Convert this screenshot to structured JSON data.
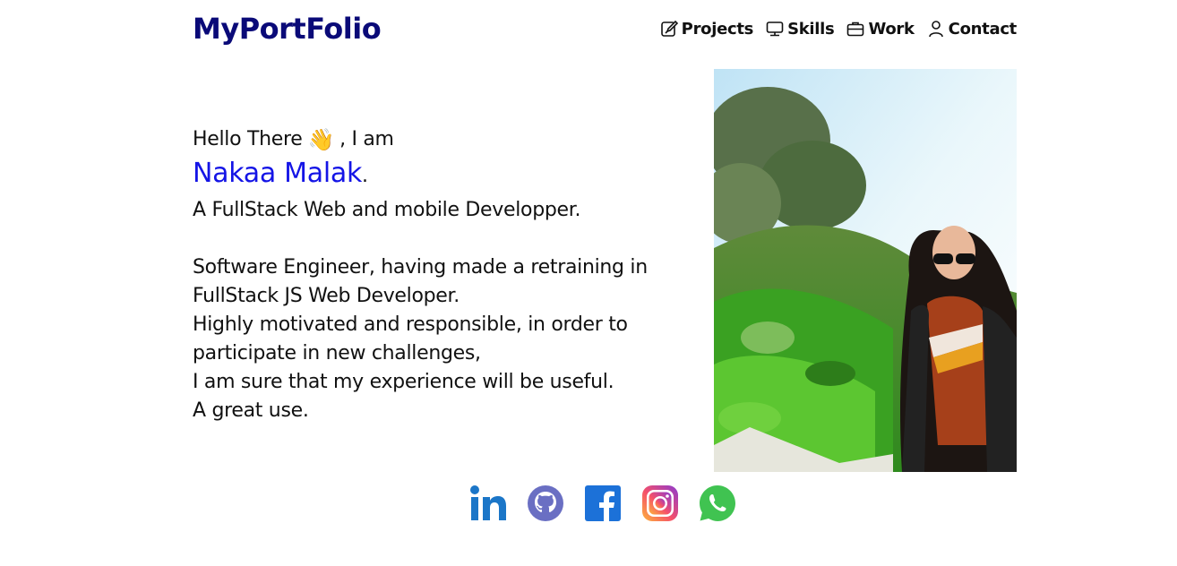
{
  "header": {
    "logo": "MyPortFolio",
    "nav": [
      {
        "label": "Projects",
        "icon": "edit-icon"
      },
      {
        "label": "Skills",
        "icon": "monitor-icon"
      },
      {
        "label": "Work",
        "icon": "briefcase-icon"
      },
      {
        "label": "Contact",
        "icon": "person-icon"
      }
    ]
  },
  "intro": {
    "greeting_before": "Hello There",
    "wave": "👋",
    "greeting_after": ", I am",
    "name": "Nakaa Malak",
    "name_dot": ".",
    "role": "A FullStack Web and mobile Developper.",
    "bio": [
      "Software Engineer, having made a retraining in",
      "FullStack JS Web Developer.",
      "Highly motivated and responsible, in order to",
      "participate in new challenges,",
      "I am sure that my experience will be useful.",
      "A great use."
    ]
  },
  "colors": {
    "logo": "#0a0a78",
    "name": "#1414e6",
    "linkedin": "#1b76c8",
    "github": "#6a6fc3",
    "facebook": "#1c71d8",
    "whatsapp": "#40c351"
  },
  "socials": [
    {
      "name": "linkedin-icon"
    },
    {
      "name": "github-icon"
    },
    {
      "name": "facebook-icon"
    },
    {
      "name": "instagram-icon"
    },
    {
      "name": "whatsapp-icon"
    }
  ]
}
